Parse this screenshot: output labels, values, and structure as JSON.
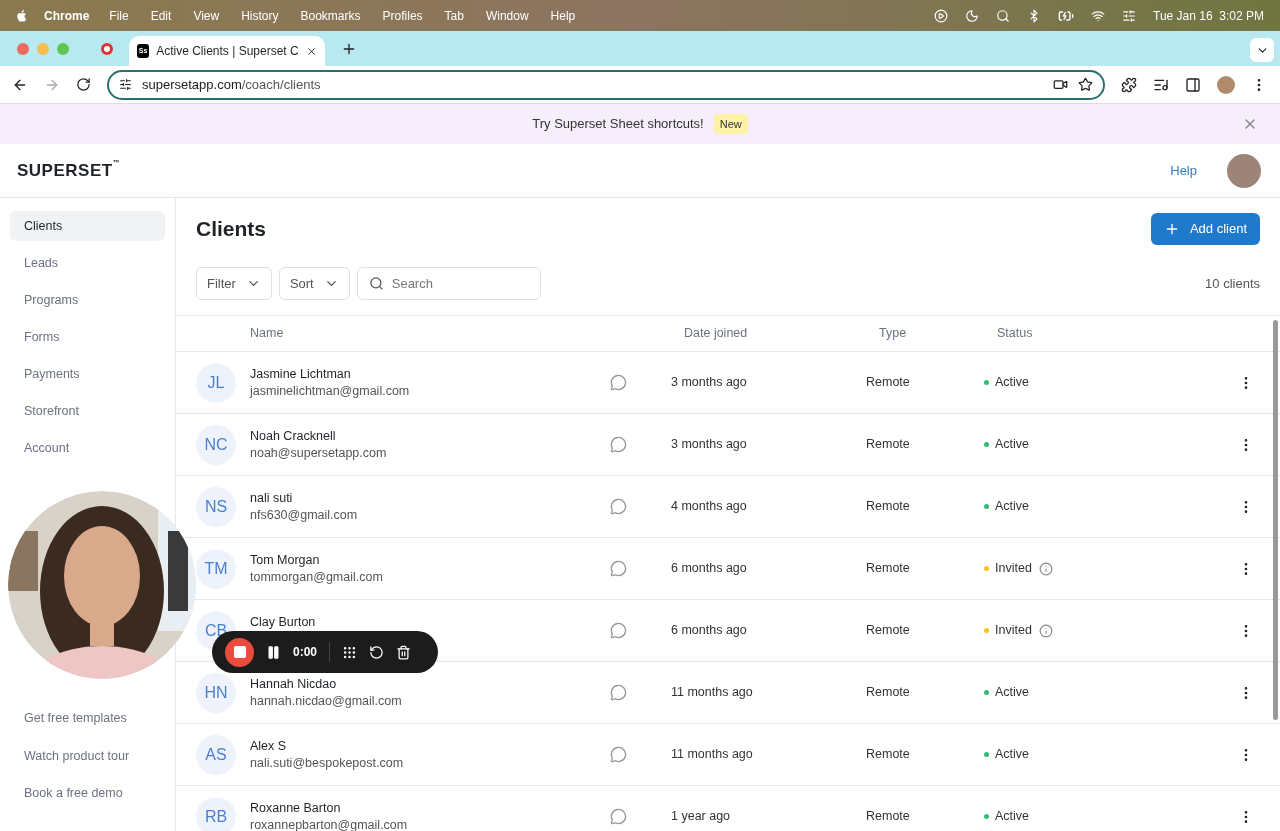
{
  "menu_bar": {
    "app": "Chrome",
    "items": [
      "File",
      "Edit",
      "View",
      "History",
      "Bookmarks",
      "Profiles",
      "Tab",
      "Window",
      "Help"
    ],
    "clock": "Tue Jan 16  3:02 PM"
  },
  "browser": {
    "tab_title": "Active Clients | Superset C",
    "favicon": "Ss",
    "url_host": "supersetapp.com",
    "url_path": "/coach/clients"
  },
  "banner": {
    "text": "Try Superset Sheet shortcuts!",
    "badge": "New"
  },
  "header": {
    "logo": "SUPERSET",
    "trademark": "™",
    "help": "Help"
  },
  "sidebar": {
    "items": [
      {
        "label": "Clients",
        "selected": true
      },
      {
        "label": "Leads",
        "selected": false
      },
      {
        "label": "Programs",
        "selected": false
      },
      {
        "label": "Forms",
        "selected": false
      },
      {
        "label": "Payments",
        "selected": false
      },
      {
        "label": "Storefront",
        "selected": false
      },
      {
        "label": "Account",
        "selected": false
      }
    ],
    "footer_links": [
      "Get free templates",
      "Watch product tour",
      "Book a free demo"
    ]
  },
  "page": {
    "title": "Clients",
    "add_button": "Add client",
    "filter": "Filter",
    "sort": "Sort",
    "search_placeholder": "Search",
    "count": "10 clients"
  },
  "table": {
    "columns": [
      "Name",
      "Date joined",
      "Type",
      "Status"
    ],
    "rows": [
      {
        "initials": "JL",
        "name": "Jasmine Lichtman",
        "email": "jasminelichtman@gmail.com",
        "joined": "3 months ago",
        "type": "Remote",
        "status": "Active",
        "color": "#2fbf71",
        "info": false
      },
      {
        "initials": "NC",
        "name": "Noah Cracknell",
        "email": "noah@supersetapp.com",
        "joined": "3 months ago",
        "type": "Remote",
        "status": "Active",
        "color": "#2fbf71",
        "info": false
      },
      {
        "initials": "NS",
        "name": "nali suti",
        "email": "nfs630@gmail.com",
        "joined": "4 months ago",
        "type": "Remote",
        "status": "Active",
        "color": "#2fbf71",
        "info": false
      },
      {
        "initials": "TM",
        "name": "Tom Morgan",
        "email": "tommorgan@gmail.com",
        "joined": "6 months ago",
        "type": "Remote",
        "status": "Invited",
        "color": "#f5c518",
        "info": true
      },
      {
        "initials": "CB",
        "name": "Clay Burton",
        "joined": "6 months ago",
        "type": "Remote",
        "status": "Invited",
        "color": "#f5c518",
        "info": true
      },
      {
        "initials": "HN",
        "name": "Hannah Nicdao",
        "email": "hannah.nicdao@gmail.com",
        "joined": "11 months ago",
        "type": "Remote",
        "status": "Active",
        "color": "#2fbf71",
        "info": false
      },
      {
        "initials": "AS",
        "name": "Alex S",
        "email": "nali.suti@bespokepost.com",
        "joined": "11 months ago",
        "type": "Remote",
        "status": "Active",
        "color": "#2fbf71",
        "info": false
      },
      {
        "initials": "RB",
        "name": "Roxanne Barton",
        "email": "roxannepbarton@gmail.com",
        "joined": "1 year ago",
        "type": "Remote",
        "status": "Active",
        "color": "#2fbf71",
        "info": false
      }
    ]
  },
  "recorder": {
    "timer": "0:00"
  }
}
